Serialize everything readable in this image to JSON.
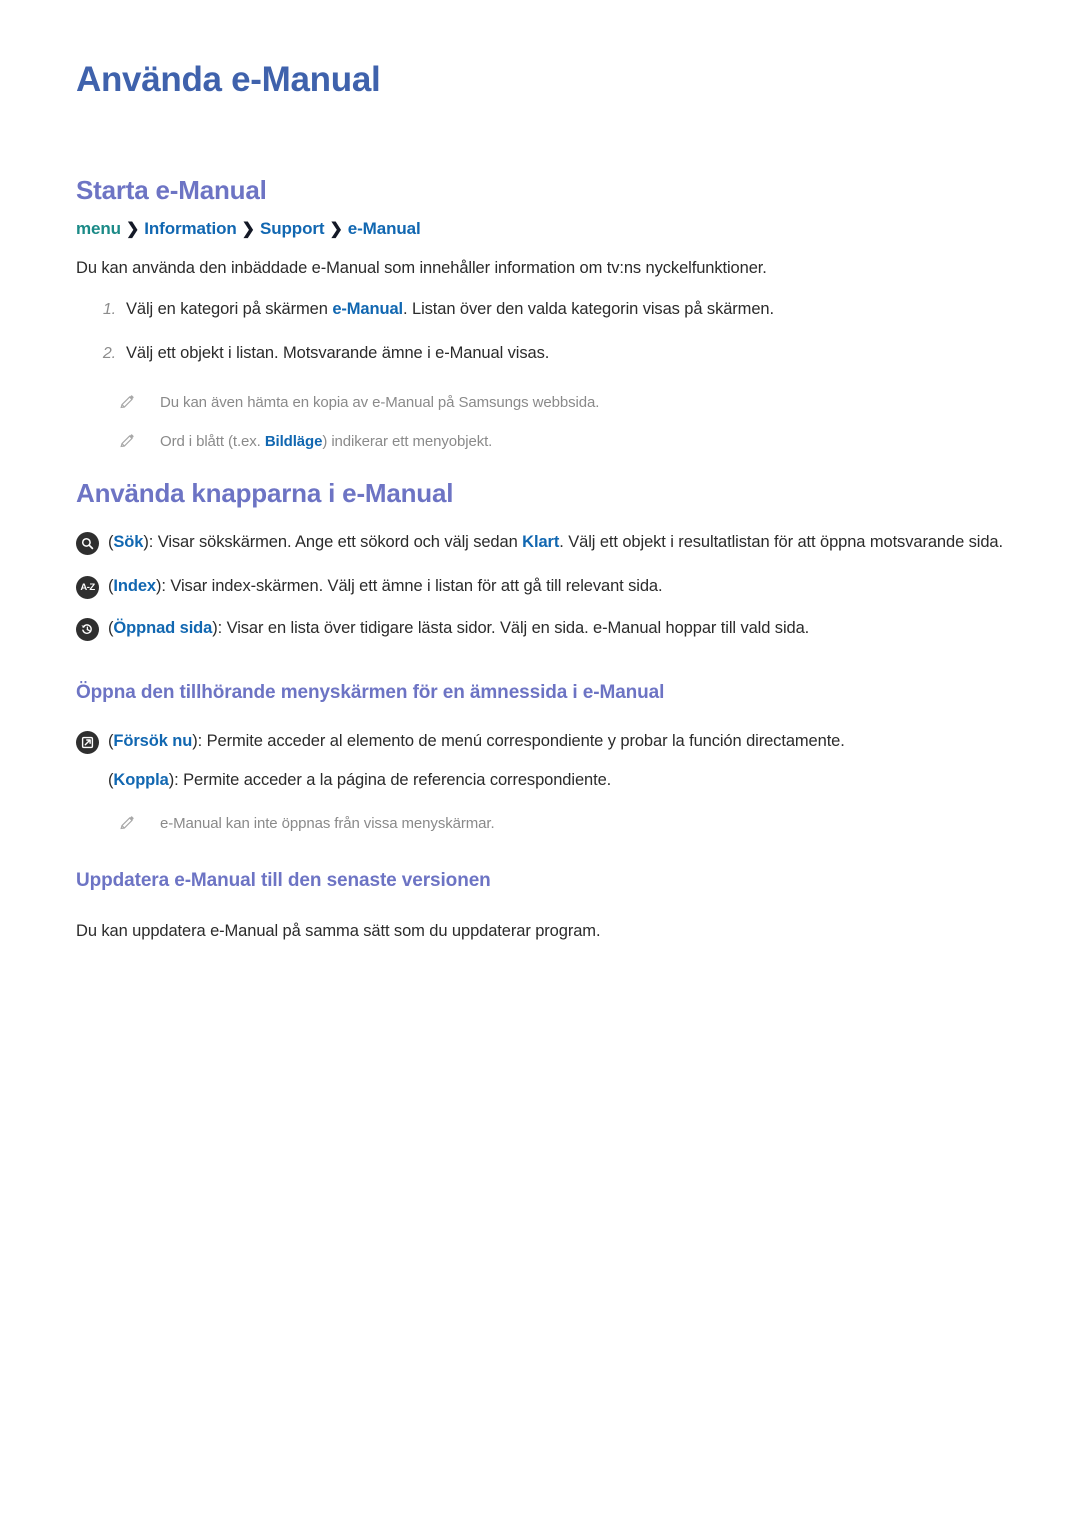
{
  "page": {
    "title": "Använda e-Manual"
  },
  "sections": {
    "starta": {
      "heading": "Starta e-Manual",
      "breadcrumb": {
        "menu": "menu",
        "sep": "❯",
        "information": "Information",
        "support": "Support",
        "emanual": "e-Manual"
      },
      "intro": "Du kan använda den inbäddade e-Manual som innehåller information om tv:ns nyckelfunktioner.",
      "steps": [
        {
          "marker": "1.",
          "pre": "Välj en kategori på skärmen ",
          "term": "e-Manual",
          "post": ". Listan över den valda kategorin visas på skärmen."
        },
        {
          "marker": "2.",
          "pre": "Välj ett objekt i listan. Motsvarande ämne i e-Manual visas.",
          "term": "",
          "post": ""
        }
      ],
      "notes": [
        {
          "icon": "pencil-icon",
          "pre": "Du kan även hämta en kopia av e-Manual på Samsungs webbsida.",
          "term": "",
          "post": ""
        },
        {
          "icon": "pencil-icon",
          "pre": "Ord i blått (t.ex. ",
          "term": "Bildläge",
          "post": ") indikerar ett menyobjekt."
        }
      ]
    },
    "knapparna": {
      "heading": "Använda knapparna i e-Manual",
      "items": [
        {
          "icon": "search-icon",
          "open_paren": "(",
          "term": "Sök",
          "mid": "): Visar sökskärmen. Ange ett sökord och välj sedan ",
          "term2": "Klart",
          "post": ". Välj ett objekt i resultatlistan för att öppna motsvarande sida."
        },
        {
          "icon": "index-az-icon",
          "open_paren": "(",
          "term": "Index",
          "mid": "): Visar index-skärmen. Välj ett ämne i listan för att gå till relevant sida.",
          "term2": "",
          "post": ""
        },
        {
          "icon": "history-clock-icon",
          "open_paren": "(",
          "term": "Öppnad sida",
          "mid": "): Visar en lista över tidigare lästa sidor. Välj en sida. e-Manual hoppar till vald sida.",
          "term2": "",
          "post": ""
        }
      ]
    },
    "oppna": {
      "heading": "Öppna den tillhörande menyskärmen för en ämnessida i e-Manual",
      "items": [
        {
          "icon": "try-now-external-link-icon",
          "open_paren": "(",
          "term": "Försök nu",
          "post": "): Permite acceder al elemento de menú correspondiente y probar la función directamente."
        },
        {
          "icon": "none",
          "open_paren": "(",
          "term": "Koppla",
          "post": "): Permite acceder a la página de referencia correspondiente."
        }
      ],
      "notes": [
        {
          "icon": "pencil-icon",
          "pre": "e-Manual kan inte öppnas från vissa menyskärmar.",
          "term": "",
          "post": ""
        }
      ]
    },
    "uppdatera": {
      "heading": "Uppdatera e-Manual till den senaste versionen",
      "paragraph": "Du kan uppdatera e-Manual på samma sätt som du uppdaterar program."
    }
  },
  "colors": {
    "title_blue": "#3f62ac",
    "heading_purple": "#6d74c4",
    "link_blue": "#1167b1",
    "menu_teal": "#1b8a87",
    "body_gray": "#2b2b2b",
    "note_gray": "#8a8a8a",
    "icon_dark": "#2f2f2f"
  }
}
